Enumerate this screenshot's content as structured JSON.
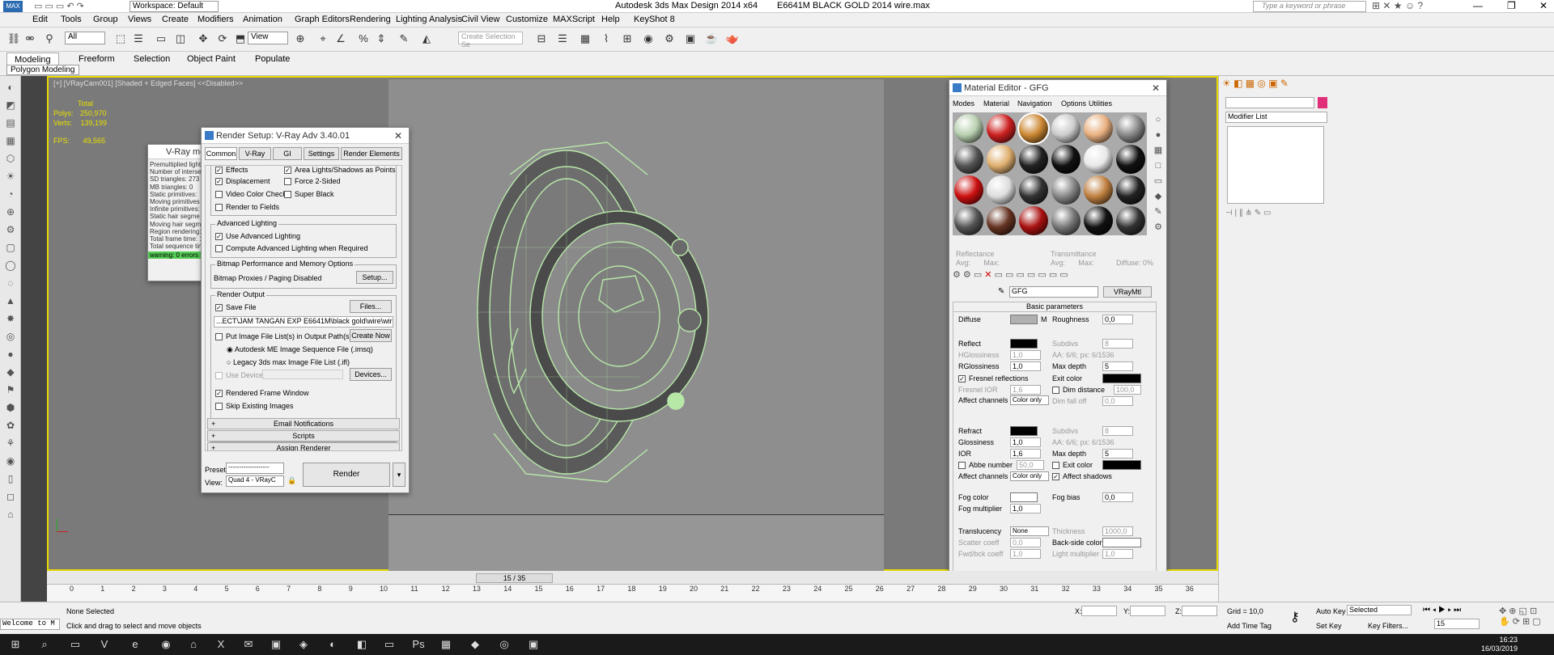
{
  "titlebar": {
    "workspace": "Workspace: Default",
    "app_title": "Autodesk 3ds Max Design 2014 x64",
    "file_title": "E6641M BLACK GOLD 2014 wire.max",
    "search_placeholder": "Type a keyword or phrase"
  },
  "menus": [
    "Edit",
    "Tools",
    "Group",
    "Views",
    "Create",
    "Modifiers",
    "Animation",
    "Graph Editors",
    "Rendering",
    "Lighting Analysis",
    "Civil View",
    "Customize",
    "MAXScript",
    "Help",
    "KeyShot 8"
  ],
  "toolbar": {
    "filter": "All",
    "view": "View",
    "selection_set": "Create Selection Se"
  },
  "ribbon": {
    "tabs": [
      "Modeling",
      "Freeform",
      "Selection",
      "Object Paint",
      "Populate"
    ],
    "sub": "Polygon Modeling"
  },
  "viewport": {
    "label": "[+] [VRayCam001] [Shaded + Edged Faces] <<Disabled>>",
    "stats": {
      "total": "Total",
      "polys_label": "Polys:",
      "polys": "250,970",
      "verts_label": "Verts:",
      "verts": "139,199",
      "fps_label": "FPS:",
      "fps": "49,565"
    }
  },
  "vray_messages": {
    "title": "V-Ray me",
    "lines": [
      "Premultiplied light c",
      "Number of intersec",
      "SD triangles: 273",
      "MB triangles: 0",
      "Static primitives:",
      "Moving primitives",
      "Infinite primitives:",
      "Static hair segme",
      "Moving hair segm",
      "Region rendering:",
      "Total frame time: 1",
      "Total sequence tim"
    ],
    "warning": "warning: 0 errors"
  },
  "render_setup": {
    "title": "Render Setup: V-Ray Adv 3.40.01",
    "tabs": [
      "Common",
      "V-Ray",
      "GI",
      "Settings",
      "Render Elements"
    ],
    "options": {
      "effects": "Effects",
      "area_lights": "Area Lights/Shadows as Points",
      "displacement": "Displacement",
      "force_2sided": "Force 2-Sided",
      "video_color_check": "Video Color Check",
      "super_black": "Super Black",
      "render_to_fields": "Render to Fields"
    },
    "advanced_lighting": {
      "header": "Advanced Lighting",
      "use": "Use Advanced Lighting",
      "compute": "Compute Advanced Lighting when Required"
    },
    "bitmap": {
      "header": "Bitmap Performance and Memory Options",
      "text": "Bitmap Proxies / Paging Disabled",
      "setup_btn": "Setup..."
    },
    "output": {
      "header": "Render Output",
      "save_file": "Save File",
      "files_btn": "Files...",
      "path": "...ECT\\JAM TANGAN EXP E6641M\\black gold\\wire\\wire -.png",
      "put_list": "Put Image File List(s) in Output Path(s)",
      "create_now": "Create Now",
      "imsq": "Autodesk ME Image Sequence File (.imsq)",
      "ifl": "Legacy 3ds max Image File List (.ifl)",
      "use_device": "Use Device",
      "devices_btn": "Devices...",
      "rendered_frame_window": "Rendered Frame Window",
      "skip_existing": "Skip Existing Images"
    },
    "rollouts": [
      "Email Notifications",
      "Scripts",
      "Assign Renderer"
    ],
    "preset_label": "Preset:",
    "preset_value": "-------------------",
    "view_label": "View:",
    "view_value": "Quad 4 - VRayC",
    "render_btn": "Render"
  },
  "material_editor": {
    "title": "Material Editor - GFG",
    "menus": [
      "Modes",
      "Material",
      "Navigation",
      "Options",
      "Utilities"
    ],
    "swatch_colors": [
      "#b8d0b0",
      "#cc2020",
      "#cc8833",
      "#cccccc",
      "#e8b080",
      "#888888",
      "#555555",
      "#e0b070",
      "#222222",
      "#111111",
      "#e8e8e8",
      "#111111",
      "#cc1010",
      "#dddddd",
      "#333333",
      "#888888",
      "#c08040",
      "#222222",
      "#555555",
      "#663322",
      "#aa1111",
      "#777777",
      "#111111",
      "#333333"
    ],
    "reflectance": "Reflectance",
    "transmittance": "Transmittance",
    "avg": "Avg:",
    "max": "Max:",
    "diffuse_pct": "Diffuse:",
    "diffuse_pct_val": "0%",
    "material_name": "GFG",
    "material_type": "VRayMtl",
    "basic_params": "Basic parameters",
    "params": {
      "diffuse": "Diffuse",
      "roughness": "Roughness",
      "roughness_val": "0,0",
      "reflect": "Reflect",
      "subdivs": "Subdivs",
      "subdivs_val": "8",
      "hglossiness": "HGlossiness",
      "hgloss_val": "1,0",
      "aa": "AA: 6/6; px: 6/1536",
      "rglossiness": "RGlossiness",
      "rgloss_val": "1,0",
      "max_depth": "Max depth",
      "max_depth_val": "5",
      "fresnel": "Fresnel reflections",
      "exit_color": "Exit color",
      "fresnel_ior": "Fresnel IOR",
      "fresnel_ior_val": "1,6",
      "dim_distance": "Dim distance",
      "dim_distance_val": "100,0",
      "affect_channels": "Affect channels",
      "color_only": "Color only",
      "dim_falloff": "Dim fall off",
      "dim_falloff_val": "0,0",
      "refract": "Refract",
      "glossiness": "Glossiness",
      "glossiness_val": "1,0",
      "ior": "IOR",
      "ior_val": "1,6",
      "abbe": "Abbe number",
      "abbe_val": "50,0",
      "affect_shadows": "Affect shadows",
      "fog_color": "Fog color",
      "fog_bias": "Fog bias",
      "fog_bias_val": "0,0",
      "fog_multiplier": "Fog multiplier",
      "fog_mult_val": "1,0",
      "translucency": "Translucency",
      "transl_val": "None",
      "thickness": "Thickness",
      "thickness_val": "1000,0",
      "scatter_coeff": "Scatter coeff",
      "scatter_val": "0,0",
      "backside_color": "Back-side color",
      "fwd_bck": "Fwd/bck coeff",
      "fwd_val": "1,0",
      "light_mult": "Light multiplier",
      "light_mult_val": "1,0"
    }
  },
  "command_panel": {
    "modifier_list": "Modifier List"
  },
  "timeline": {
    "frame": "15 / 35",
    "ticks": [
      "0",
      "1",
      "2",
      "3",
      "4",
      "5",
      "6",
      "7",
      "8",
      "9",
      "10",
      "11",
      "12",
      "13",
      "14",
      "15",
      "16",
      "17",
      "18",
      "19",
      "20",
      "21",
      "22",
      "23",
      "24",
      "25",
      "26",
      "27",
      "28",
      "29",
      "30",
      "31",
      "32",
      "33",
      "34",
      "35",
      "36"
    ]
  },
  "status": {
    "welcome": "Welcome to M",
    "none_selected": "None Selected",
    "prompt": "Click and drag to select and move objects",
    "x_label": "X:",
    "y_label": "Y:",
    "z_label": "Z:",
    "grid": "Grid = 10,0",
    "add_time_tag": "Add Time Tag",
    "auto_key": "Auto Key",
    "selected": "Selected",
    "set_key": "Set Key",
    "key_filters": "Key Filters...",
    "frame_field": "15"
  },
  "clock": {
    "time": "16:23",
    "date": "16/03/2019"
  },
  "colors": {
    "viewport_border": "#e8d800",
    "wire": "#b8e8a8",
    "accent": "#1e6fc0"
  }
}
